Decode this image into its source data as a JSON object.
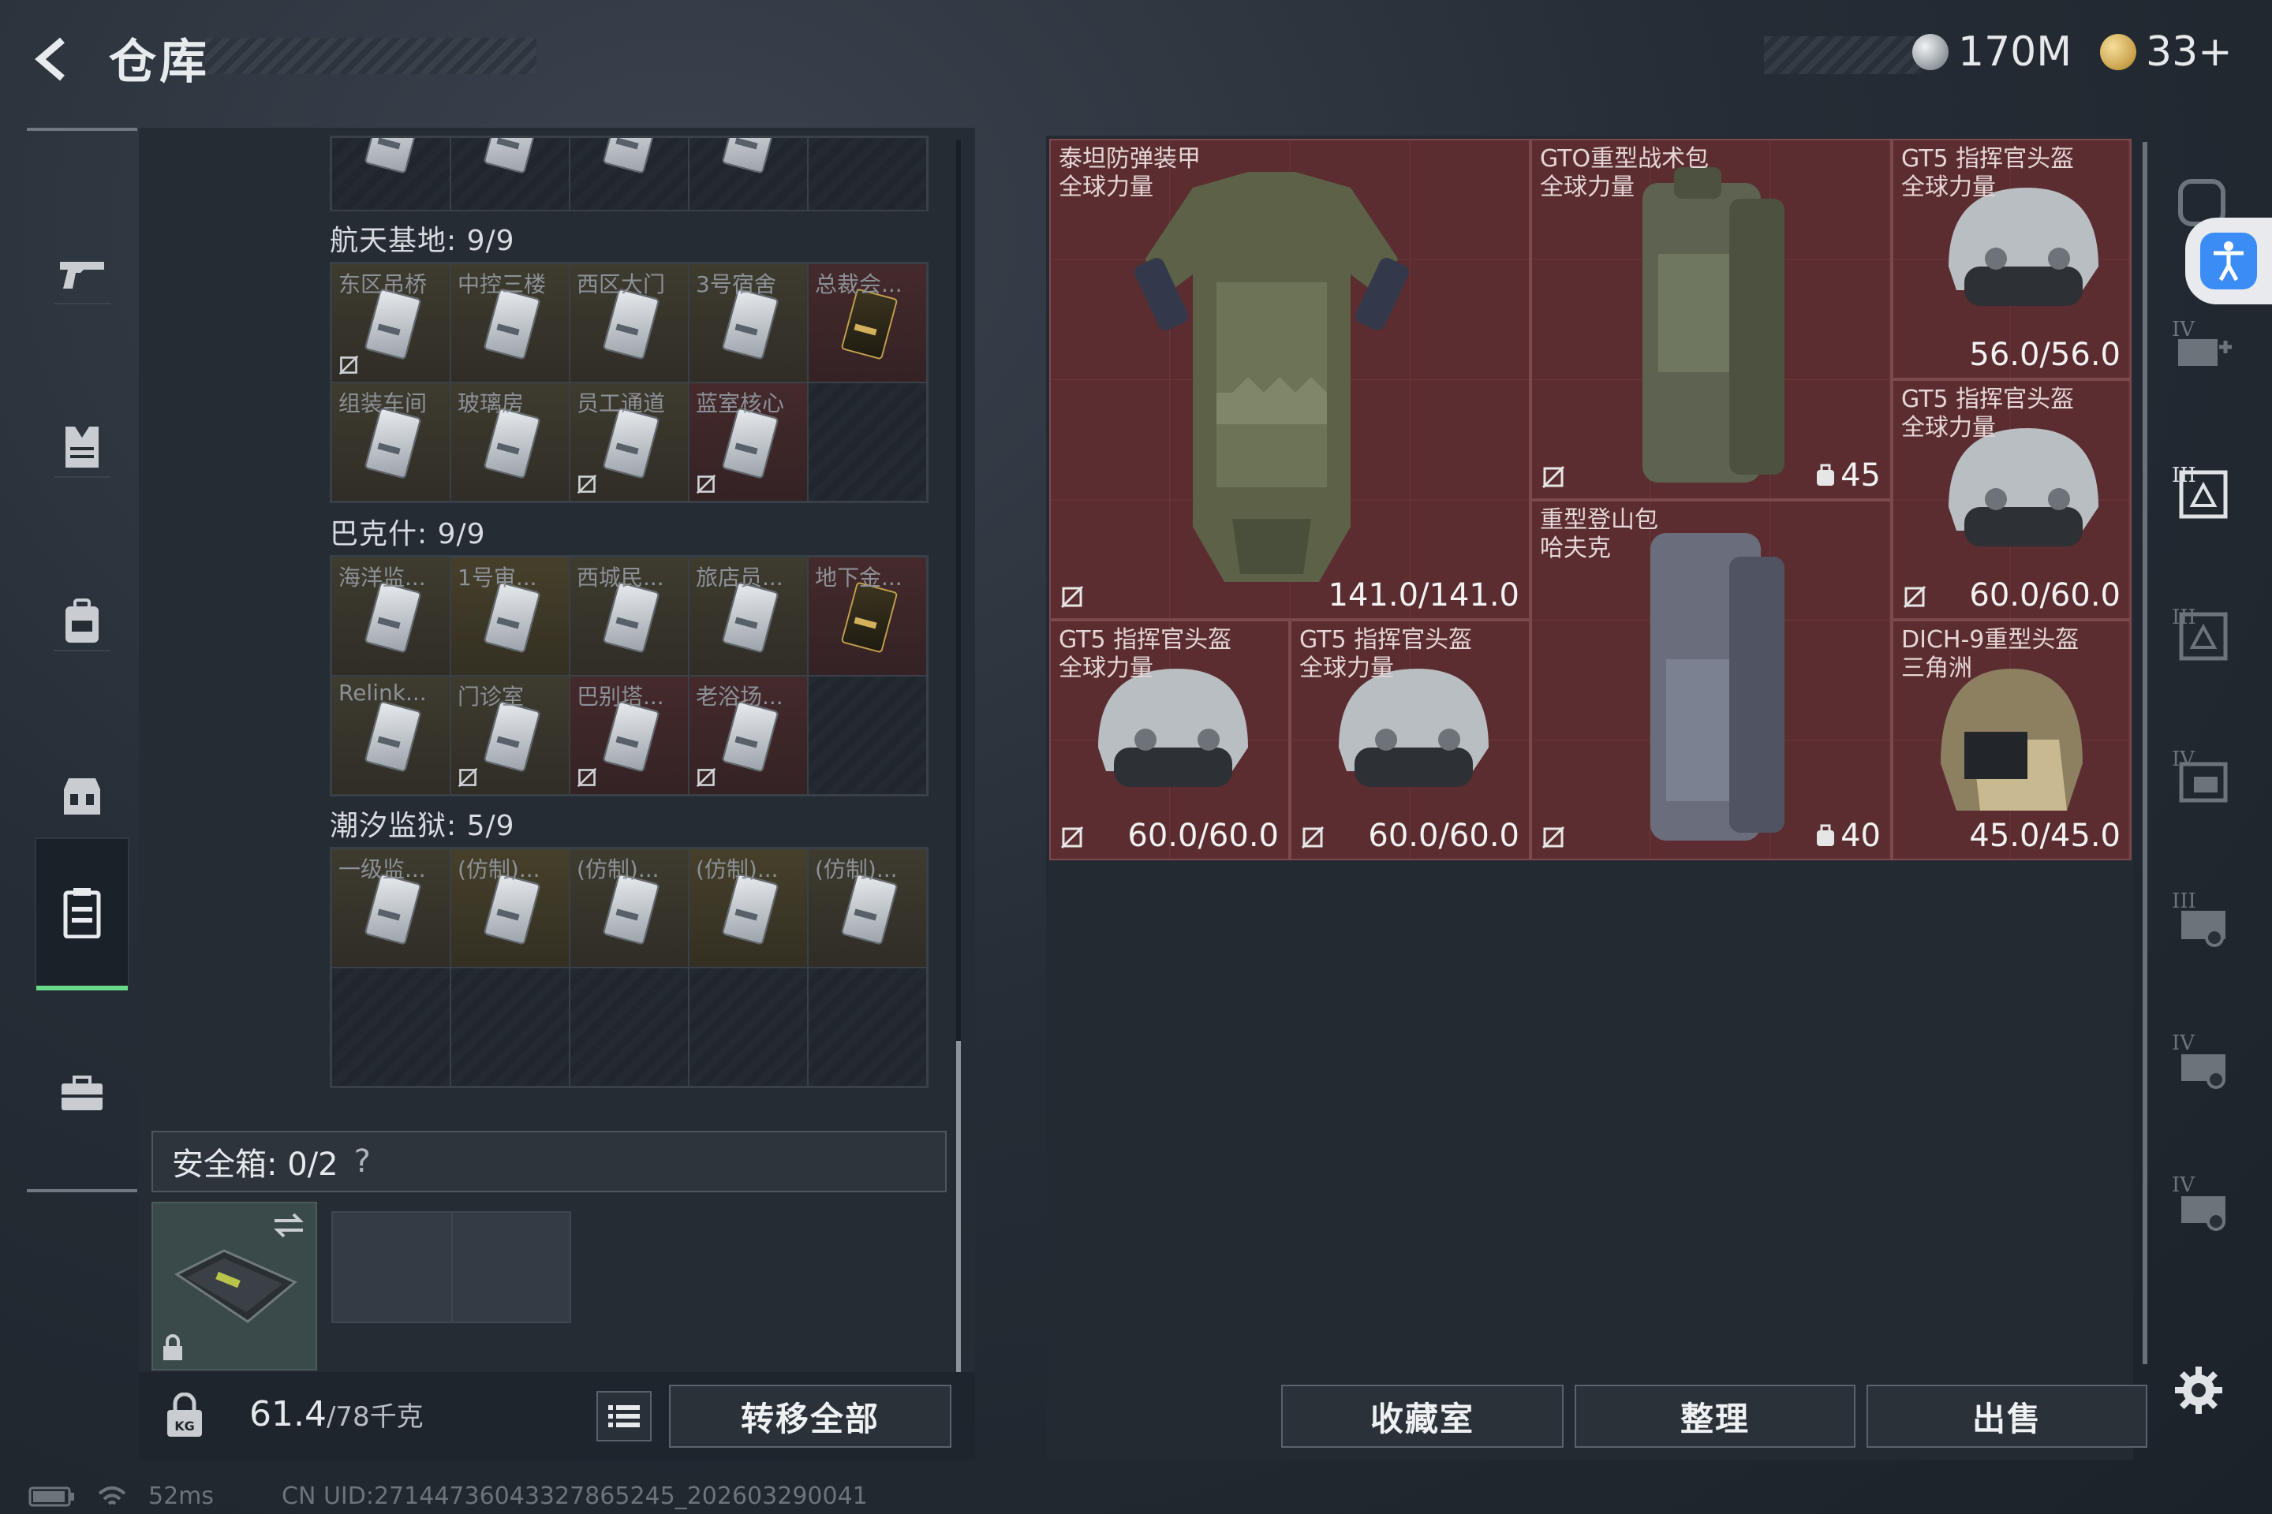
{
  "header": {
    "title": "仓库",
    "currency_silver": "170M",
    "currency_gold": "33+"
  },
  "nav": {
    "items": [
      "weapons",
      "armor",
      "backpack",
      "chest-rig",
      "keys",
      "case"
    ],
    "active": "keys"
  },
  "stash": {
    "regions": [
      {
        "name": "航天基地: 9/9",
        "cells": [
          {
            "label": "东区吊桥",
            "tint": "yellow",
            "gold": false,
            "nosell": true
          },
          {
            "label": "中控三楼",
            "tint": "yellow",
            "gold": false,
            "nosell": false
          },
          {
            "label": "西区大门",
            "tint": "yellow",
            "gold": false,
            "nosell": false
          },
          {
            "label": "3号宿舍",
            "tint": "yellow",
            "gold": false,
            "nosell": false
          },
          {
            "label": "总裁会...",
            "tint": "red",
            "gold": true,
            "nosell": false
          },
          {
            "label": "组装车间",
            "tint": "yellow",
            "gold": false,
            "nosell": false
          },
          {
            "label": "玻璃房",
            "tint": "yellow",
            "gold": false,
            "nosell": false
          },
          {
            "label": "员工通道",
            "tint": "yellow",
            "gold": false,
            "nosell": true
          },
          {
            "label": "蓝室核心",
            "tint": "red",
            "gold": false,
            "nosell": true
          },
          {
            "label": "",
            "tint": "dark",
            "gold": false,
            "nosell": false
          }
        ]
      },
      {
        "name": "巴克什: 9/9",
        "cells": [
          {
            "label": "海洋监...",
            "tint": "yellow",
            "gold": false,
            "nosell": false
          },
          {
            "label": "1号审...",
            "tint": "gold",
            "gold": false,
            "nosell": false
          },
          {
            "label": "西城民...",
            "tint": "yellow",
            "gold": false,
            "nosell": false
          },
          {
            "label": "旅店员...",
            "tint": "yellow",
            "gold": false,
            "nosell": false
          },
          {
            "label": "地下金...",
            "tint": "red",
            "gold": true,
            "nosell": false
          },
          {
            "label": "Relink...",
            "tint": "yellow",
            "gold": false,
            "nosell": false
          },
          {
            "label": "门诊室",
            "tint": "yellow",
            "gold": false,
            "nosell": true
          },
          {
            "label": "巴别塔...",
            "tint": "red",
            "gold": false,
            "nosell": true
          },
          {
            "label": "老浴场...",
            "tint": "red",
            "gold": false,
            "nosell": true
          },
          {
            "label": "",
            "tint": "dark",
            "gold": false,
            "nosell": false
          }
        ]
      },
      {
        "name": "潮汐监狱: 5/9",
        "cells": [
          {
            "label": "一级监...",
            "tint": "yellow",
            "gold": false,
            "nosell": false
          },
          {
            "label": "(仿制)...",
            "tint": "gold",
            "gold": false,
            "nosell": false
          },
          {
            "label": "(仿制)...",
            "tint": "yellow",
            "gold": false,
            "nosell": false
          },
          {
            "label": "(仿制)...",
            "tint": "gold",
            "gold": false,
            "nosell": false
          },
          {
            "label": "(仿制)...",
            "tint": "yellow",
            "gold": false,
            "nosell": false
          },
          {
            "label": "",
            "tint": "dark",
            "gold": false,
            "nosell": false
          },
          {
            "label": "",
            "tint": "dark",
            "gold": false,
            "nosell": false
          },
          {
            "label": "",
            "tint": "dark",
            "gold": false,
            "nosell": false
          },
          {
            "label": "",
            "tint": "dark",
            "gold": false,
            "nosell": false
          },
          {
            "label": "",
            "tint": "dark",
            "gold": false,
            "nosell": false
          }
        ]
      }
    ]
  },
  "safe_box": {
    "label": "安全箱:  0/2",
    "help": "?"
  },
  "footer_left": {
    "weight": "61.4",
    "weight_max": "/78千克",
    "transfer_all": "转移全部"
  },
  "inventory": {
    "items": [
      {
        "id": "vest",
        "name": "泰坦防弹装甲",
        "sub": "全球力量",
        "value": "141.0/141.0",
        "kind": "durability",
        "nosell": true
      },
      {
        "id": "bag1",
        "name": "GTO重型战术包",
        "sub": "全球力量",
        "value": "45",
        "kind": "capacity",
        "nosell": true
      },
      {
        "id": "helm1",
        "name": "GT5 指挥官头盔",
        "sub": "全球力量",
        "value": "56.0/56.0",
        "kind": "durability",
        "nosell": false
      },
      {
        "id": "helm2",
        "name": "GT5 指挥官头盔",
        "sub": "全球力量",
        "value": "60.0/60.0",
        "kind": "durability",
        "nosell": true
      },
      {
        "id": "bag2",
        "name": "重型登山包",
        "sub": "哈夫克",
        "value": "40",
        "kind": "capacity",
        "nosell": true
      },
      {
        "id": "helm3",
        "name": "GT5 指挥官头盔",
        "sub": "全球力量",
        "value": "60.0/60.0",
        "kind": "durability",
        "nosell": true
      },
      {
        "id": "helm4",
        "name": "GT5 指挥官头盔",
        "sub": "全球力量",
        "value": "60.0/60.0",
        "kind": "durability",
        "nosell": true
      },
      {
        "id": "helm5",
        "name": "DICH-9重型头盔",
        "sub": "三角洲",
        "value": "45.0/45.0",
        "kind": "durability",
        "nosell": false
      }
    ],
    "buttons": {
      "collection": "收藏室",
      "organize": "整理",
      "sell": "出售"
    }
  },
  "right_filters": [
    "armor-add",
    "armor-filter",
    "helmet-filter",
    "bag-filter",
    "rig-filter",
    "case-filter",
    "case-filter-2"
  ],
  "status_bar": {
    "ping": "52ms",
    "uid": "CN UID:27144736043327865245_202603290041"
  },
  "colors": {
    "accent_green": "#69d98a",
    "item_bg_red": "#5c2d30",
    "access_blue": "#3b8cf5"
  }
}
